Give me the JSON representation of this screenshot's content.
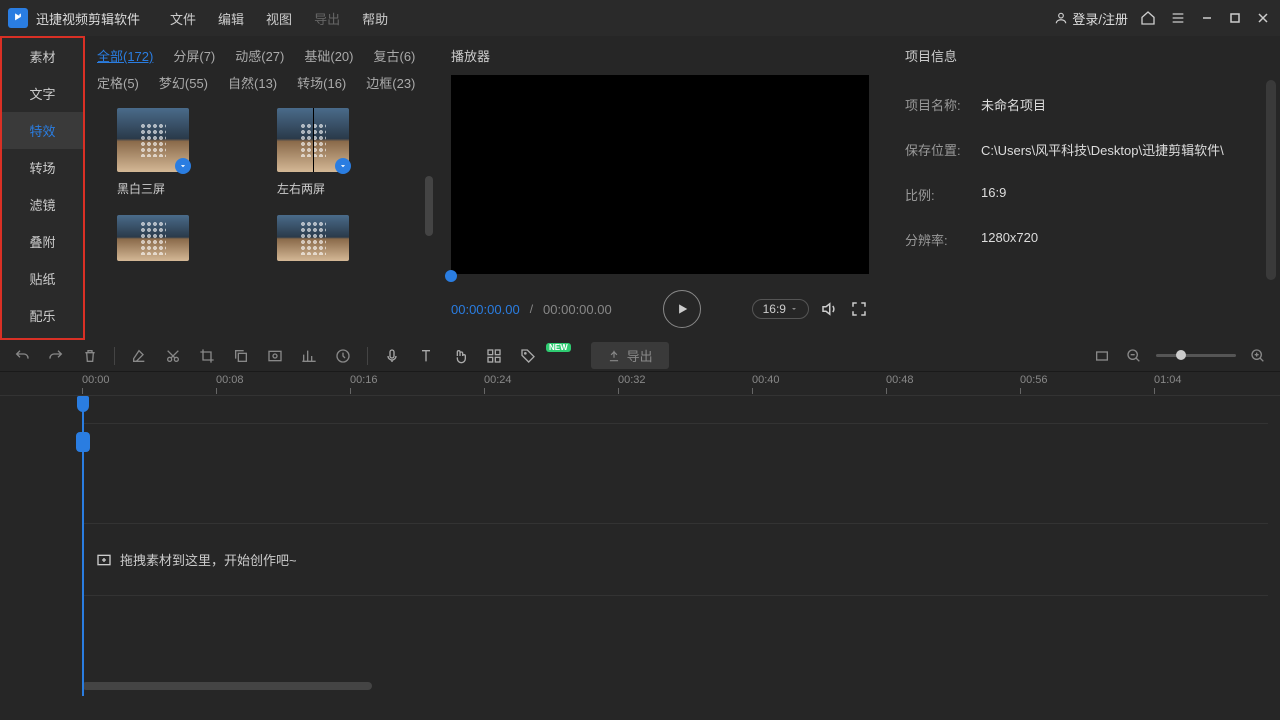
{
  "app": {
    "title": "迅捷视频剪辑软件"
  },
  "menu": {
    "file": "文件",
    "edit": "编辑",
    "view": "视图",
    "export": "导出",
    "help": "帮助"
  },
  "titlebar": {
    "login": "登录/注册"
  },
  "sidebar": {
    "items": [
      {
        "label": "素材"
      },
      {
        "label": "文字"
      },
      {
        "label": "特效"
      },
      {
        "label": "转场"
      },
      {
        "label": "滤镜"
      },
      {
        "label": "叠附"
      },
      {
        "label": "贴纸"
      },
      {
        "label": "配乐"
      }
    ]
  },
  "filters": [
    {
      "label": "全部(172)",
      "active": true
    },
    {
      "label": "分屏(7)"
    },
    {
      "label": "动感(27)"
    },
    {
      "label": "基础(20)"
    },
    {
      "label": "复古(6)"
    },
    {
      "label": "定格(5)"
    },
    {
      "label": "梦幻(55)"
    },
    {
      "label": "自然(13)"
    },
    {
      "label": "转场(16)"
    },
    {
      "label": "边框(23)"
    }
  ],
  "effects": [
    {
      "name": "黑白三屏"
    },
    {
      "name": "左右两屏"
    }
  ],
  "player": {
    "header": "播放器",
    "cur": "00:00:00.00",
    "sep": "/",
    "tot": "00:00:00.00",
    "ratio": "16:9"
  },
  "proj": {
    "header": "项目信息",
    "name_label": "项目名称:",
    "name_val": "未命名项目",
    "path_label": "保存位置:",
    "path_val": "C:\\Users\\风平科技\\Desktop\\迅捷剪辑软件\\",
    "ratio_label": "比例:",
    "ratio_val": "16:9",
    "res_label": "分辨率:",
    "res_val": "1280x720"
  },
  "toolbar": {
    "export": "导出",
    "new": "NEW"
  },
  "ruler": [
    "00:00",
    "00:08",
    "00:16",
    "00:24",
    "00:32",
    "00:40",
    "00:48",
    "00:56",
    "01:04"
  ],
  "timeline": {
    "hint": "拖拽素材到这里，开始创作吧~"
  }
}
